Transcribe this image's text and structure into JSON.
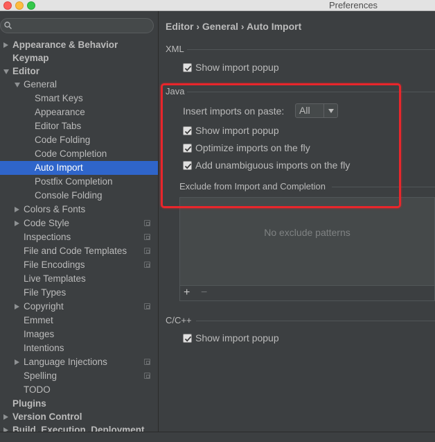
{
  "window": {
    "title": "Preferences"
  },
  "search": {
    "placeholder": ""
  },
  "tree": [
    {
      "label": "Appearance & Behavior",
      "level": 0,
      "bold": true,
      "arrow": "right",
      "project": false,
      "selected": false
    },
    {
      "label": "Keymap",
      "level": 0,
      "bold": true,
      "arrow": "none",
      "project": false,
      "selected": false
    },
    {
      "label": "Editor",
      "level": 0,
      "bold": true,
      "arrow": "down",
      "project": false,
      "selected": false
    },
    {
      "label": "General",
      "level": 1,
      "bold": false,
      "arrow": "down",
      "project": false,
      "selected": false
    },
    {
      "label": "Smart Keys",
      "level": 2,
      "bold": false,
      "arrow": "none",
      "project": false,
      "selected": false
    },
    {
      "label": "Appearance",
      "level": 2,
      "bold": false,
      "arrow": "none",
      "project": false,
      "selected": false
    },
    {
      "label": "Editor Tabs",
      "level": 2,
      "bold": false,
      "arrow": "none",
      "project": false,
      "selected": false
    },
    {
      "label": "Code Folding",
      "level": 2,
      "bold": false,
      "arrow": "none",
      "project": false,
      "selected": false
    },
    {
      "label": "Code Completion",
      "level": 2,
      "bold": false,
      "arrow": "none",
      "project": false,
      "selected": false
    },
    {
      "label": "Auto Import",
      "level": 2,
      "bold": false,
      "arrow": "none",
      "project": false,
      "selected": true
    },
    {
      "label": "Postfix Completion",
      "level": 2,
      "bold": false,
      "arrow": "none",
      "project": false,
      "selected": false
    },
    {
      "label": "Console Folding",
      "level": 2,
      "bold": false,
      "arrow": "none",
      "project": false,
      "selected": false
    },
    {
      "label": "Colors & Fonts",
      "level": 1,
      "bold": false,
      "arrow": "right",
      "project": false,
      "selected": false
    },
    {
      "label": "Code Style",
      "level": 1,
      "bold": false,
      "arrow": "right",
      "project": true,
      "selected": false
    },
    {
      "label": "Inspections",
      "level": 1,
      "bold": false,
      "arrow": "none",
      "project": true,
      "selected": false
    },
    {
      "label": "File and Code Templates",
      "level": 1,
      "bold": false,
      "arrow": "none",
      "project": true,
      "selected": false
    },
    {
      "label": "File Encodings",
      "level": 1,
      "bold": false,
      "arrow": "none",
      "project": true,
      "selected": false
    },
    {
      "label": "Live Templates",
      "level": 1,
      "bold": false,
      "arrow": "none",
      "project": false,
      "selected": false
    },
    {
      "label": "File Types",
      "level": 1,
      "bold": false,
      "arrow": "none",
      "project": false,
      "selected": false
    },
    {
      "label": "Copyright",
      "level": 1,
      "bold": false,
      "arrow": "right",
      "project": true,
      "selected": false
    },
    {
      "label": "Emmet",
      "level": 1,
      "bold": false,
      "arrow": "none",
      "project": false,
      "selected": false
    },
    {
      "label": "Images",
      "level": 1,
      "bold": false,
      "arrow": "none",
      "project": false,
      "selected": false
    },
    {
      "label": "Intentions",
      "level": 1,
      "bold": false,
      "arrow": "none",
      "project": false,
      "selected": false
    },
    {
      "label": "Language Injections",
      "level": 1,
      "bold": false,
      "arrow": "right",
      "project": true,
      "selected": false
    },
    {
      "label": "Spelling",
      "level": 1,
      "bold": false,
      "arrow": "none",
      "project": true,
      "selected": false
    },
    {
      "label": "TODO",
      "level": 1,
      "bold": false,
      "arrow": "none",
      "project": false,
      "selected": false
    },
    {
      "label": "Plugins",
      "level": 0,
      "bold": true,
      "arrow": "none",
      "project": false,
      "selected": false
    },
    {
      "label": "Version Control",
      "level": 0,
      "bold": true,
      "arrow": "right",
      "project": false,
      "selected": false
    },
    {
      "label": "Build, Execution, Deployment",
      "level": 0,
      "bold": true,
      "arrow": "right",
      "project": false,
      "selected": false
    }
  ],
  "breadcrumb": "Editor › General › Auto Import",
  "xml": {
    "title": "XML",
    "show_popup_label": "Show import popup",
    "show_popup_checked": true
  },
  "java": {
    "title": "Java",
    "insert_label": "Insert imports on paste:",
    "insert_value": "All",
    "show_popup_label": "Show import popup",
    "show_popup_checked": true,
    "optimize_label": "Optimize imports on the fly",
    "optimize_checked": true,
    "unambiguous_label": "Add unambiguous imports on the fly",
    "unambiguous_checked": true,
    "exclude_title": "Exclude from Import and Completion",
    "exclude_empty": "No exclude patterns",
    "add_symbol": "+",
    "remove_symbol": "−"
  },
  "cpp": {
    "title": "C/C++",
    "show_popup_label": "Show import popup",
    "show_popup_checked": true
  },
  "colors": {
    "selection": "#2f65ca",
    "highlight_box": "#e9262b"
  }
}
